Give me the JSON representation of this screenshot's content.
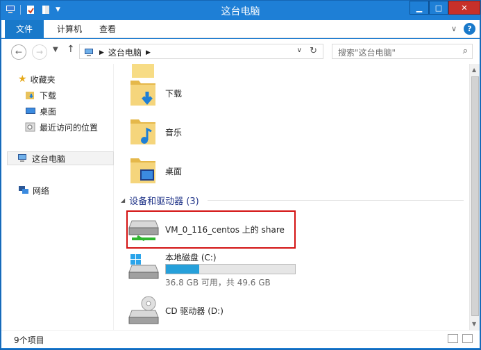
{
  "window": {
    "title": "这台电脑"
  },
  "ribbon": {
    "tabs": [
      "文件",
      "计算机",
      "查看"
    ]
  },
  "address": {
    "crumbs": [
      "这台电脑"
    ],
    "search_placeholder": "搜索\"这台电脑\""
  },
  "nav": {
    "favorites_label": "收藏夹",
    "favorites": [
      "下载",
      "桌面",
      "最近访问的位置"
    ],
    "this_pc": "这台电脑",
    "network": "网络"
  },
  "main": {
    "folders": [
      {
        "label": "下载",
        "icon": "downloads-folder-icon"
      },
      {
        "label": "音乐",
        "icon": "music-folder-icon"
      },
      {
        "label": "桌面",
        "icon": "desktop-folder-icon"
      }
    ],
    "group_label": "设备和驱动器 (3)",
    "drives": [
      {
        "label": "VM_0_116_centos 上的 share",
        "icon": "network-drive-icon"
      },
      {
        "label": "本地磁盘 (C:)",
        "icon": "local-disk-icon",
        "usage_fraction": 0.258,
        "subtext": "36.8 GB 可用，共 49.6 GB"
      },
      {
        "label": "CD 驱动器 (D:)",
        "icon": "cd-drive-icon"
      }
    ]
  },
  "status": {
    "count": "9个项目"
  },
  "colors": {
    "accent": "#1979ca",
    "highlight": "#d31212",
    "bar": "#26a0da"
  }
}
